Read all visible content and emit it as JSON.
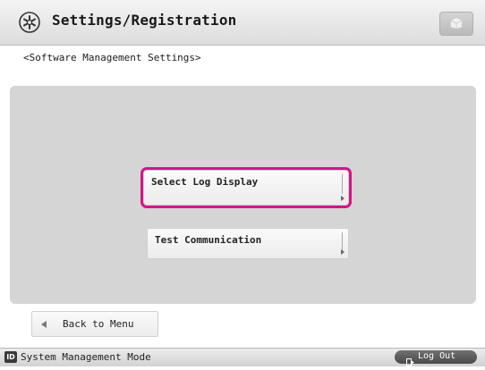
{
  "header": {
    "title": "Settings/Registration",
    "icon": "settings-gear-icon",
    "home_icon": "home-box-icon"
  },
  "subtitle": "<Software Management Settings>",
  "main": {
    "buttons": [
      {
        "label": "Select Log Display",
        "selected": true,
        "highlight_color": "#d6138a"
      },
      {
        "label": "Test Communication",
        "selected": false
      }
    ]
  },
  "footer": {
    "back_label": "Back to Menu",
    "mode_badge": "ID",
    "mode_text": "System Management Mode",
    "logout_label": "Log Out"
  }
}
